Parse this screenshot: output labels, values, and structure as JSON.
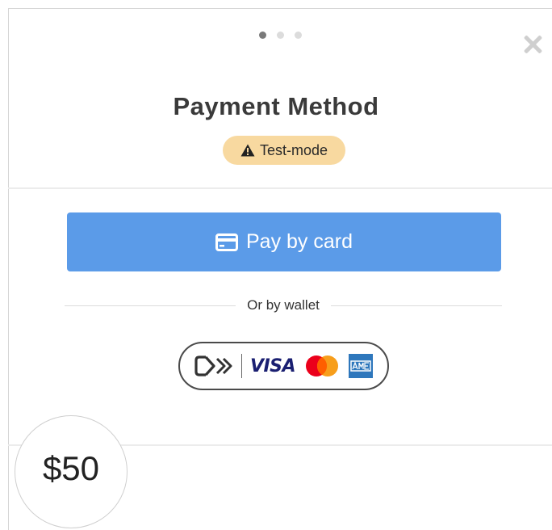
{
  "steps": {
    "total": 3,
    "current": 1
  },
  "header": {
    "title": "Payment Method",
    "badge_label": "Test-mode"
  },
  "pay_button": {
    "label": "Pay by card"
  },
  "wallet": {
    "divider_label": "Or by wallet",
    "brands": [
      "link-icon",
      "visa",
      "mastercard",
      "amex"
    ],
    "visa_text": "VISA"
  },
  "summary": {
    "amount": "$50"
  },
  "colors": {
    "primary": "#5b9be8",
    "badge_bg": "#f8d9a0",
    "mastercard_red": "#eb001b",
    "mastercard_orange": "#f79e1b",
    "amex_blue": "#2e77bc"
  }
}
